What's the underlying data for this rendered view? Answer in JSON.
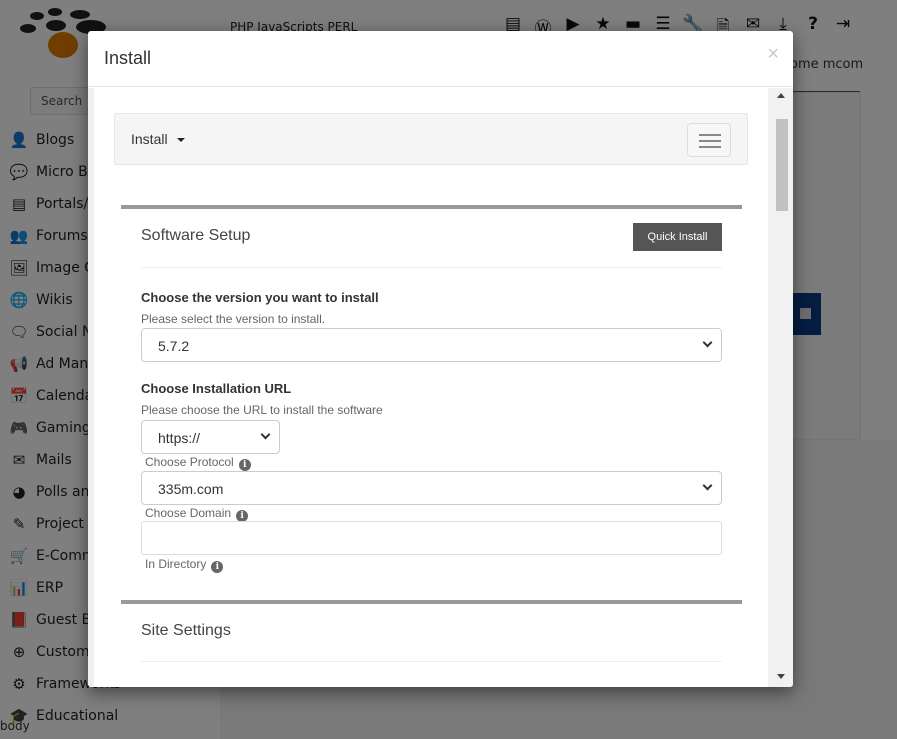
{
  "background": {
    "topnav_text": "PHP  JavaScripts  PERL",
    "top_icons": [
      {
        "name": "cpanel-icon",
        "glyph": "▤"
      },
      {
        "name": "wordpress-icon",
        "glyph": "Ⓦ"
      },
      {
        "name": "play-icon",
        "glyph": "▶"
      },
      {
        "name": "star-icon",
        "glyph": "★"
      },
      {
        "name": "archive-icon",
        "glyph": "▬"
      },
      {
        "name": "list-icon",
        "glyph": "☰"
      },
      {
        "name": "wrench-icon",
        "glyph": "🔧"
      },
      {
        "name": "file-zip-icon",
        "glyph": "🗎"
      },
      {
        "name": "mail-icon",
        "glyph": "✉"
      },
      {
        "name": "download-icon",
        "glyph": "⤓"
      },
      {
        "name": "help-icon",
        "glyph": "?"
      },
      {
        "name": "logout-icon",
        "glyph": "⇥"
      }
    ],
    "welcome_text": "ome mcom",
    "search_placeholder": "Search",
    "sidebar_items": [
      {
        "label": "Blogs",
        "icon": "user-icon",
        "glyph": "👤"
      },
      {
        "label": "Micro Blogs",
        "icon": "chat-bubbles-icon",
        "glyph": "💬"
      },
      {
        "label": "Portals/CMS",
        "icon": "list-box-icon",
        "glyph": "▤"
      },
      {
        "label": "Forums",
        "icon": "users-icon",
        "glyph": "👥"
      },
      {
        "label": "Image Galleries",
        "icon": "image-icon",
        "glyph": "🖼"
      },
      {
        "label": "Wikis",
        "icon": "globe-icon",
        "glyph": "🌐"
      },
      {
        "label": "Social Networking",
        "icon": "comments-icon",
        "glyph": "🗨"
      },
      {
        "label": "Ad Management",
        "icon": "megaphone-icon",
        "glyph": "📢"
      },
      {
        "label": "Calendars",
        "icon": "calendar-icon",
        "glyph": "📅"
      },
      {
        "label": "Gaming",
        "icon": "gamepad-icon",
        "glyph": "🎮"
      },
      {
        "label": "Mails",
        "icon": "envelope-icon",
        "glyph": "✉"
      },
      {
        "label": "Polls and Analytics",
        "icon": "pie-chart-icon",
        "glyph": "◕"
      },
      {
        "label": "Project Management",
        "icon": "edit-icon",
        "glyph": "✎"
      },
      {
        "label": "E-Commerce",
        "icon": "cart-icon",
        "glyph": "🛒"
      },
      {
        "label": "ERP",
        "icon": "bar-chart-icon",
        "glyph": "📊"
      },
      {
        "label": "Guest Books",
        "icon": "book-icon",
        "glyph": "📕"
      },
      {
        "label": "Customer Support",
        "icon": "lifebuoy-icon",
        "glyph": "⊕"
      },
      {
        "label": "Frameworks",
        "icon": "gears-icon",
        "glyph": "⚙"
      },
      {
        "label": "Educational",
        "icon": "graduation-cap-icon",
        "glyph": "🎓"
      }
    ],
    "body_label": "body"
  },
  "modal": {
    "title": "Install",
    "close_glyph": "×",
    "subnav": {
      "label": "Install"
    },
    "software_setup": {
      "title": "Software Setup",
      "quick_install_label": "Quick Install",
      "version": {
        "label": "Choose the version you want to install",
        "help": "Please select the version to install.",
        "value": "5.7.2"
      },
      "url": {
        "label": "Choose Installation URL",
        "help": "Please choose the URL to install the software",
        "protocol_value": "https://",
        "protocol_label": "Choose Protocol",
        "domain_value": "335m.com",
        "domain_label": "Choose Domain",
        "directory_value": "",
        "directory_label": "In Directory"
      }
    },
    "site_settings": {
      "title": "Site Settings"
    }
  },
  "colors": {
    "accent_orange": "#e07b00",
    "quick_install_bg": "#555555",
    "bg_primary_button": "#0b3a82",
    "section_border": "#999999"
  }
}
